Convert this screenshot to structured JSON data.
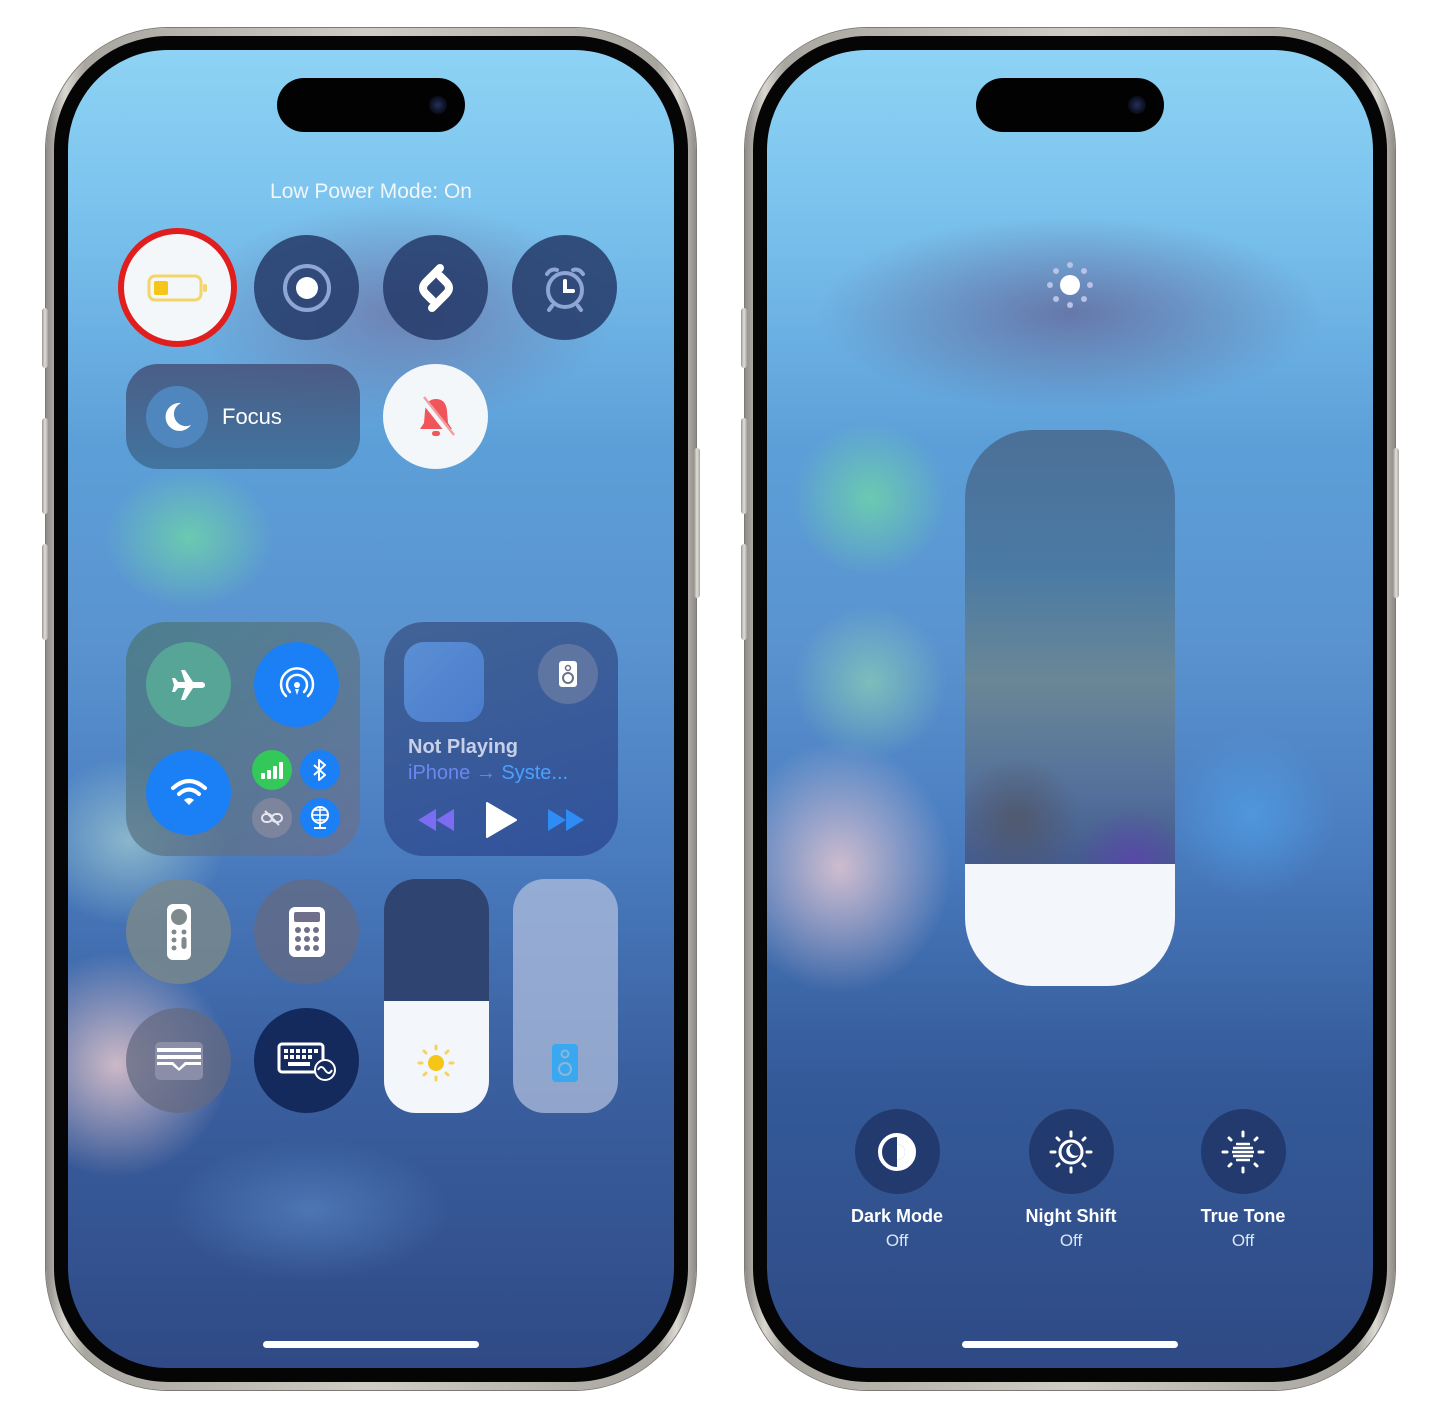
{
  "left_phone": {
    "status_text": "Low Power Mode: On",
    "toggles": [
      {
        "name": "low-power-mode",
        "icon": "battery-low-icon",
        "state": "on",
        "highlighted": true
      },
      {
        "name": "screen-recording",
        "icon": "record-icon",
        "state": "off"
      },
      {
        "name": "shazam",
        "icon": "shazam-icon",
        "state": "off"
      },
      {
        "name": "alarm",
        "icon": "alarm-clock-icon",
        "state": "off"
      }
    ],
    "focus": {
      "label": "Focus",
      "icon": "moon-icon"
    },
    "silent_mode": {
      "icon": "bell-slash-icon",
      "state": "on"
    },
    "connectivity": {
      "airplane": {
        "icon": "airplane-icon",
        "state": "off"
      },
      "airdrop": {
        "icon": "airdrop-icon",
        "state": "on"
      },
      "wifi": {
        "icon": "wifi-icon",
        "state": "on"
      },
      "cellular": {
        "icon": "cellular-bars-icon",
        "state": "on"
      },
      "bluetooth": {
        "icon": "bluetooth-icon",
        "state": "on"
      },
      "hotspot": {
        "icon": "personal-hotspot-icon",
        "state": "off"
      },
      "vpn": {
        "icon": "vpn-globe-icon",
        "state": "on"
      }
    },
    "media": {
      "title": "Not Playing",
      "source": "iPhone",
      "arrow": "→",
      "destination": "Syste...",
      "airplay_icon": "speaker-icon"
    },
    "bottom_controls": [
      {
        "name": "apple-tv-remote",
        "icon": "remote-icon"
      },
      {
        "name": "calculator",
        "icon": "calculator-icon"
      },
      {
        "name": "wallet",
        "icon": "wallet-icon"
      },
      {
        "name": "keyboard-brightness",
        "icon": "keyboard-icon"
      }
    ],
    "brightness_level": 0.48,
    "volume_level": 0.0,
    "colors": {
      "low_power_ring": "#e11e1e",
      "battery_yellow": "#f5c518",
      "accent_blue": "#1b7ff5",
      "cellular_green": "#34c759",
      "bell_red": "#f0555a"
    }
  },
  "right_phone": {
    "brightness_icon": "sun-icon",
    "brightness_level": 0.22,
    "options": [
      {
        "label": "Dark Mode",
        "state": "Off",
        "icon": "dark-mode-icon"
      },
      {
        "label": "Night Shift",
        "state": "Off",
        "icon": "night-shift-icon"
      },
      {
        "label": "True Tone",
        "state": "Off",
        "icon": "true-tone-icon"
      }
    ]
  }
}
